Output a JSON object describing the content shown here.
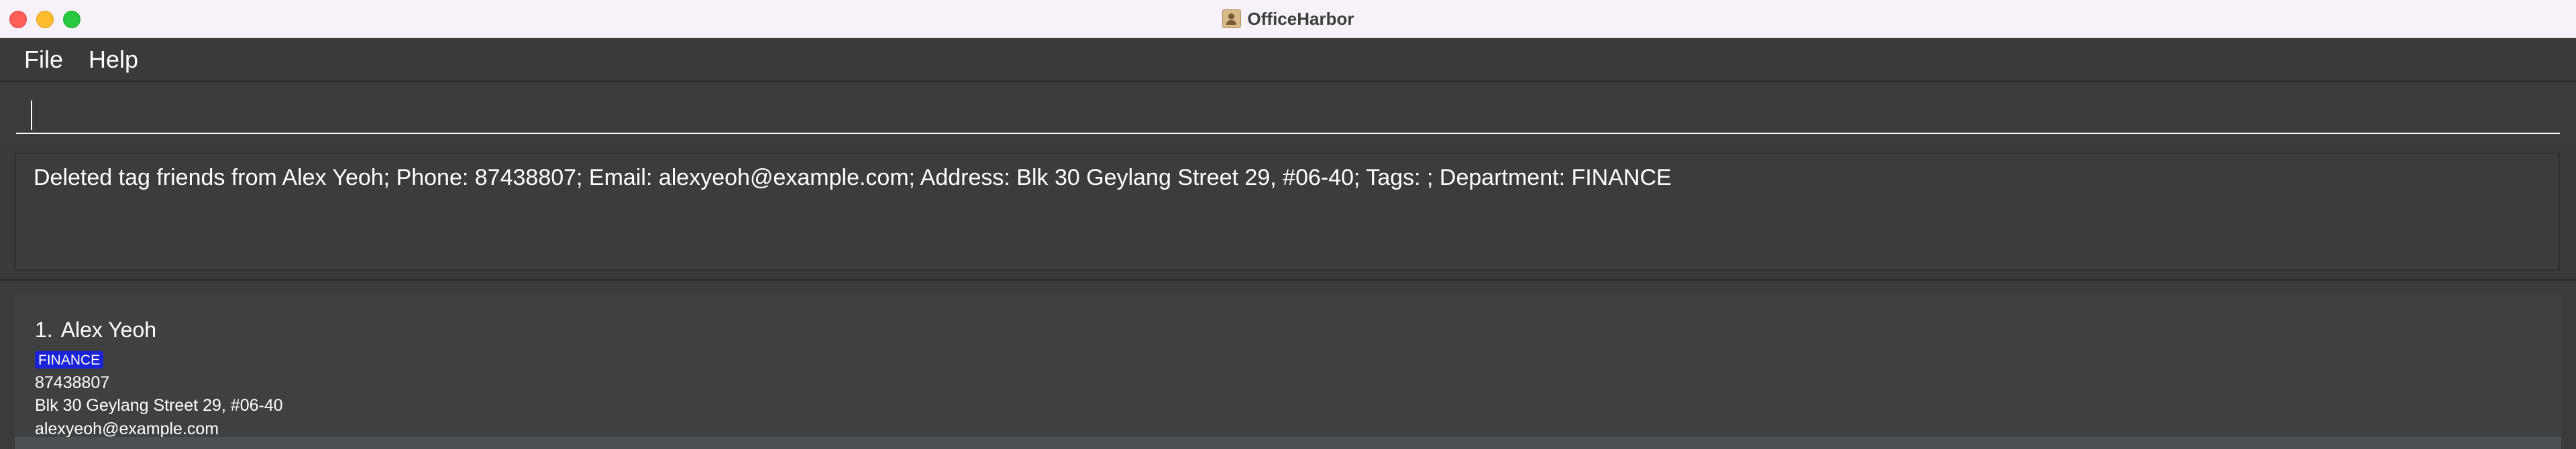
{
  "window": {
    "title": "OfficeHarbor"
  },
  "menu": {
    "items": [
      "File",
      "Help"
    ]
  },
  "command": {
    "value": "",
    "placeholder": ""
  },
  "result": {
    "message": "Deleted tag friends from Alex Yeoh; Phone: 87438807; Email: alexyeoh@example.com; Address: Blk 30 Geylang Street 29, #06-40; Tags: ; Department: FINANCE"
  },
  "persons": [
    {
      "index": "1.",
      "name": "Alex Yeoh",
      "department": "FINANCE",
      "phone": "87438807",
      "address": "Blk 30 Geylang Street 29, #06-40",
      "email": "alexyeoh@example.com"
    }
  ],
  "colors": {
    "department_tag": "#1a23d8",
    "background": "#3a3a3a",
    "titlebar": "#f7f2f9"
  },
  "icons": {
    "app": "address-book-icon",
    "window_controls": [
      "close-icon",
      "minimize-icon",
      "maximize-icon"
    ]
  }
}
